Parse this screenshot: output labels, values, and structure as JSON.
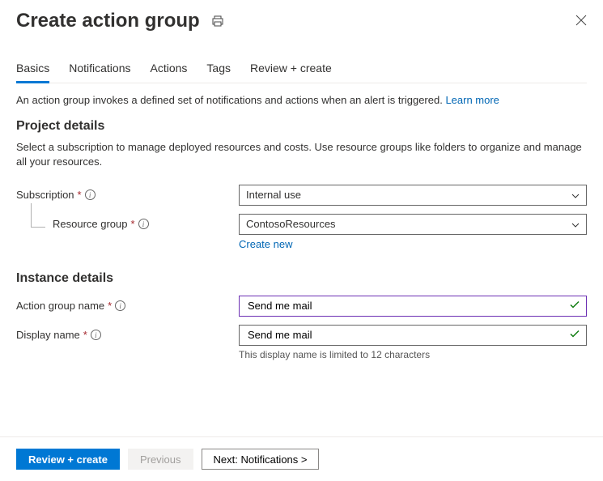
{
  "header": {
    "title": "Create action group"
  },
  "tabs": [
    {
      "label": "Basics",
      "active": true
    },
    {
      "label": "Notifications",
      "active": false
    },
    {
      "label": "Actions",
      "active": false
    },
    {
      "label": "Tags",
      "active": false
    },
    {
      "label": "Review + create",
      "active": false
    }
  ],
  "intro": {
    "text": "An action group invokes a defined set of notifications and actions when an alert is triggered. ",
    "learnMore": "Learn more"
  },
  "projectDetails": {
    "heading": "Project details",
    "help": "Select a subscription to manage deployed resources and costs. Use resource groups like folders to organize and manage all your resources.",
    "subscription": {
      "label": "Subscription",
      "value": "Internal use"
    },
    "resourceGroup": {
      "label": "Resource group",
      "value": "ContosoResources",
      "createNew": "Create new"
    }
  },
  "instanceDetails": {
    "heading": "Instance details",
    "actionGroupName": {
      "label": "Action group name",
      "value": "Send me mail"
    },
    "displayName": {
      "label": "Display name",
      "value": "Send me mail",
      "note": "This display name is limited to 12 characters"
    }
  },
  "footer": {
    "reviewCreate": "Review + create",
    "previous": "Previous",
    "next": "Next: Notifications >"
  }
}
